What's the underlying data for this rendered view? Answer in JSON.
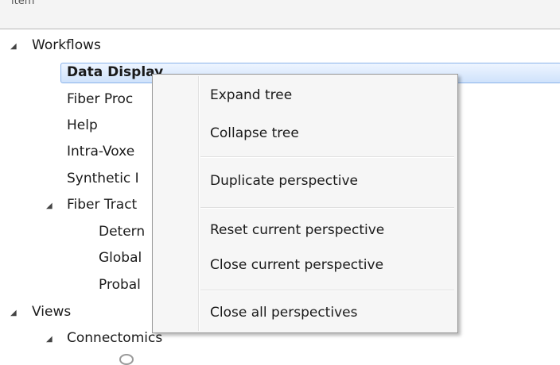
{
  "header": {
    "clipped_label": "item"
  },
  "tree": {
    "workflows": "Workflows",
    "data_display": "Data Display",
    "fiber_processing": "Fiber Proc",
    "help": "Help",
    "intra_voxel": "Intra-Voxe",
    "synthetic": "Synthetic I",
    "fiber_tract": "Fiber Tract",
    "deterministic": "Detern",
    "global": "Global",
    "probabilistic": "Probal",
    "views": "Views",
    "connectomics": "Connectomics"
  },
  "context_menu": {
    "expand_tree": "Expand tree",
    "collapse_tree": "Collapse tree",
    "duplicate_perspective": "Duplicate perspective",
    "reset_current_perspective": "Reset current perspective",
    "close_current_perspective": "Close current perspective",
    "close_all_perspectives": "Close all perspectives"
  },
  "icons": {
    "expanded_toggle": "triangle-expanded-icon",
    "node": "network-node-icon"
  }
}
